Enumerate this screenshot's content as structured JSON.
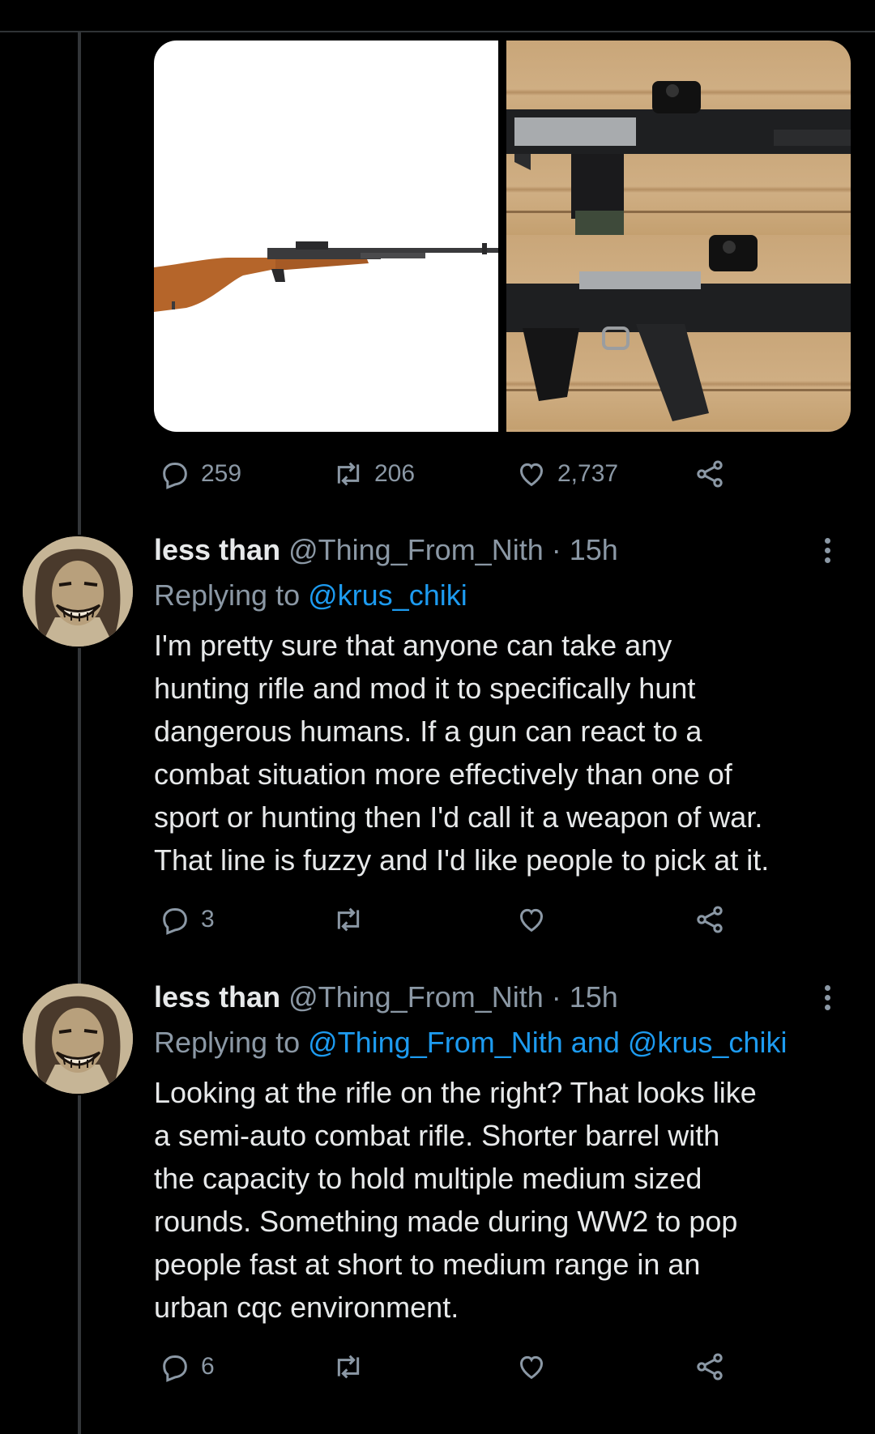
{
  "first_tweet": {
    "metrics": {
      "replies": "259",
      "retweets": "206",
      "likes": "2,737"
    }
  },
  "replies": [
    {
      "display_name": "less than",
      "handle": "@Thing_From_Nith",
      "time": "· 15h",
      "replying_label": "Replying to",
      "replying_to": "@krus_chiki",
      "text_lines": [
        "I'm pretty sure that anyone can take any",
        "hunting rifle and mod it to specifically hunt",
        "dangerous humans. If a gun can react to a",
        "combat situation more effectively than one of",
        "sport or hunting then I'd call it a weapon of war.",
        "That line is fuzzy and I'd like people to pick at it."
      ],
      "reply_count": "3"
    },
    {
      "display_name": "less than",
      "handle": "@Thing_From_Nith",
      "time": "· 15h",
      "replying_label": "Replying to",
      "replying_to": "@Thing_From_Nith and @krus_chiki",
      "text_lines": [
        "Looking at the rifle on the right? That looks like",
        "a semi-auto combat rifle. Shorter barrel with",
        "the capacity to hold multiple medium sized",
        "rounds. Something made during WW2 to pop",
        "people fast at short to medium range in an",
        "urban cqc environment."
      ],
      "reply_count": "6"
    }
  ],
  "colors": {
    "background": "#000000",
    "text": "#e7e9ea",
    "muted": "#8b98a5",
    "link": "#1d9bf0"
  },
  "icons": [
    "reply-icon",
    "retweet-icon",
    "like-icon",
    "share-icon",
    "more-icon"
  ]
}
